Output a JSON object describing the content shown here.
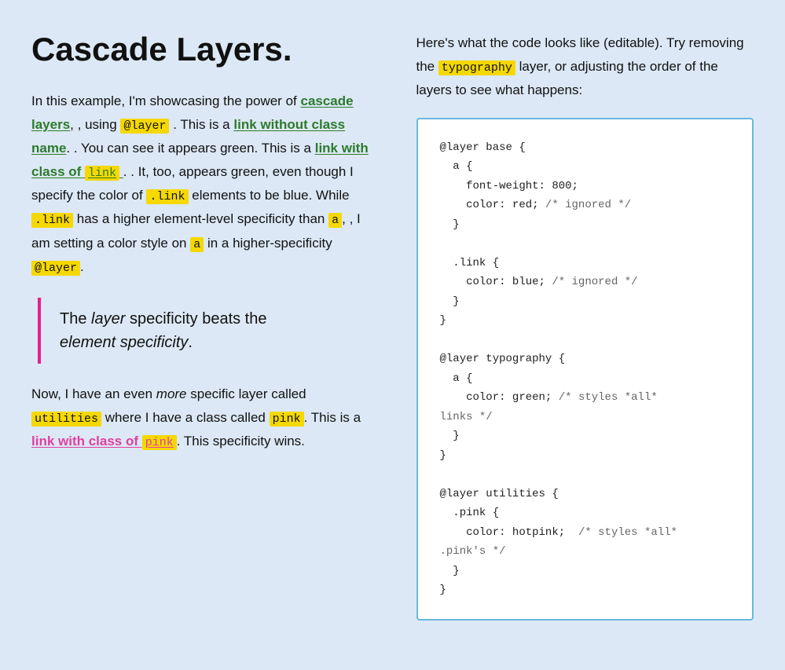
{
  "page": {
    "title": "Cascade Layers.",
    "left": {
      "intro": "In this example, I'm showcasing the power of",
      "intro2": ", using",
      "intro3": ". This is a",
      "link_no_class": "link without class name",
      "intro4": ". You can see it appears green. This is a",
      "link_with_class": "link with class of",
      "code_link": "link",
      "intro5": ". It, too, appears green, even though I specify the color of",
      "code_link2": ".link",
      "intro6": "elements to be blue. While",
      "code_link3": ".link",
      "intro7": "has a higher element-level specificity than",
      "code_a": "a",
      "intro8": ", I am setting a color style on",
      "code_a2": "a",
      "intro9": "in a higher-specificity",
      "code_layer": "@layer",
      "intro10": ".",
      "blockquote1": "The",
      "blockquote_em1": "layer",
      "blockquote2": "specificity beats the",
      "blockquote_em2": "element specificity",
      "blockquote3": ".",
      "para2_1": "Now, I have an even",
      "para2_em": "more",
      "para2_2": "specific layer called",
      "code_utilities": "utilities",
      "para2_3": "where I have a class called",
      "code_pink": "pink",
      "para2_4": ". This is a",
      "link_pink_text": "link with class of",
      "code_pink2": "pink",
      "para2_5": ". This specificity wins.",
      "cascade_layers_text": "cascade layers"
    },
    "right": {
      "intro1": "Here's what the code looks like (editable). Try removing the",
      "highlight_typography": "typography",
      "intro2": "layer, or adjusting the order of the layers to see what happens:",
      "code": "@layer base {\n  a {\n    font-weight: 800;\n    color: red; /* ignored */\n  }\n\n  .link {\n    color: blue; /* ignored */\n  }\n}\n\n@layer typography {\n  a {\n    color: green; /* styles *all*\nlinks */\n  }\n}\n\n@layer utilities {\n  .pink {\n    color: hotpink;  /* styles *all*\n.pink's */\n  }\n}"
    }
  }
}
